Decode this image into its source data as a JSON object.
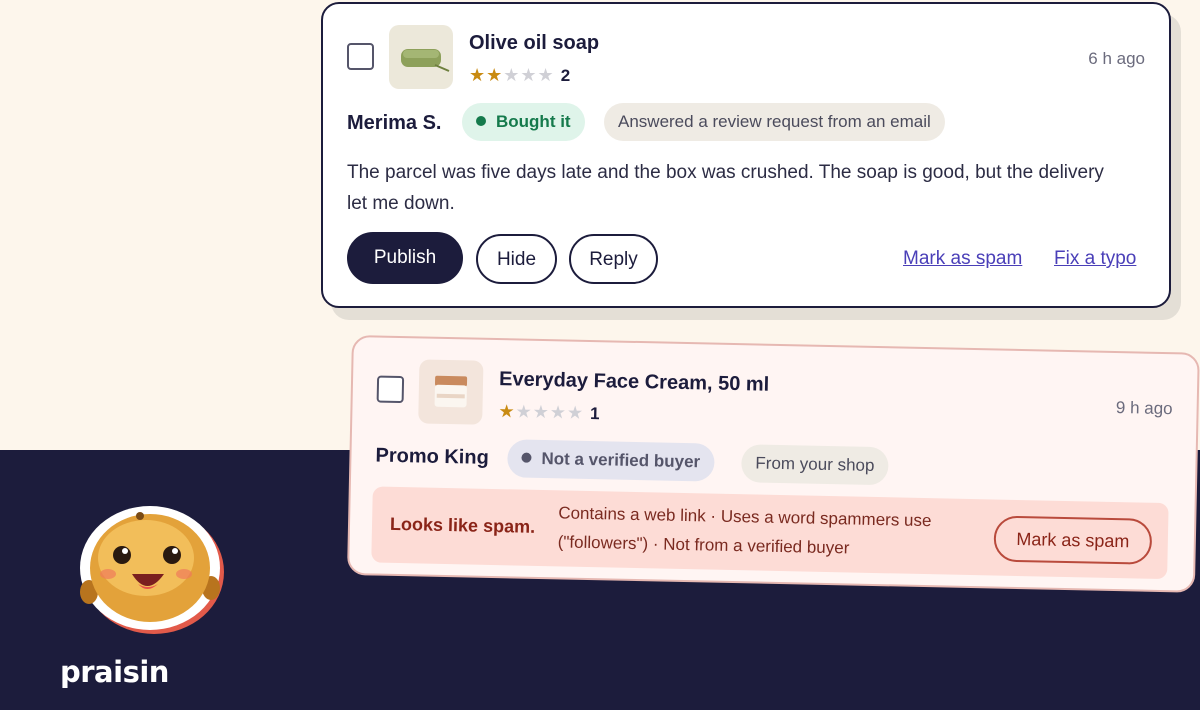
{
  "brand": {
    "name": "praisin",
    "accent": "#f28a3c",
    "navy": "#1c1c3c"
  },
  "reviews": [
    {
      "product": "Olive oil soap",
      "rating": 2,
      "rating_label": "2",
      "time": "6 h ago",
      "author": "Merima S.",
      "badge": "Bought it",
      "source": "Answered a review request from an email",
      "text": "The parcel was five days late and the box was crushed. The soap is good, but the delivery let me down.",
      "actions": {
        "publish": "Publish",
        "hide": "Hide",
        "reply": "Reply",
        "mark_spam": "Mark as spam",
        "fix_typo": "Fix a typo"
      }
    },
    {
      "product": "Everyday Face Cream, 50 ml",
      "rating": 1,
      "rating_label": "1",
      "time": "9 h ago",
      "author": "Promo King",
      "badge": "Not a verified buyer",
      "source": "From your shop",
      "spam": {
        "title": "Looks like spam.",
        "reasons_line1": "Contains a web link · Uses a word spammers use",
        "reasons_line2": "(\"followers\") · Not from a verified buyer",
        "button": "Mark as spam"
      }
    }
  ]
}
